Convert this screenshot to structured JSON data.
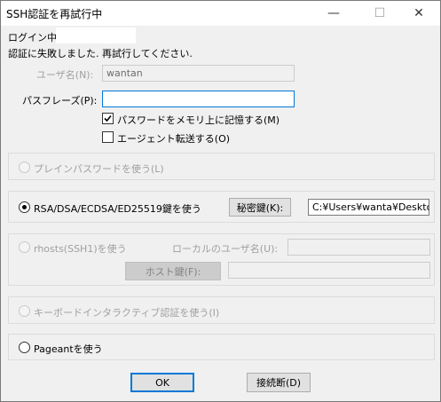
{
  "window": {
    "title": "SSH認証を再試行中",
    "minimize_glyph": "—",
    "maximize_glyph": "☐",
    "close_glyph": "✕"
  },
  "login": {
    "label": "ログイン中:",
    "message": "認証に失敗しました. 再試行してください."
  },
  "username": {
    "label": "ユーザ名(N):",
    "value": "wantan"
  },
  "passphrase": {
    "label": "パスフレーズ(P):",
    "value": ""
  },
  "options": {
    "remember_password": {
      "label": "パスワードをメモリ上に記憶する(M)",
      "checked": true
    },
    "agent_forwarding": {
      "label": "エージェント転送する(O)",
      "checked": false
    }
  },
  "auth_methods": {
    "plain_password": {
      "label": "プレインパスワードを使う(L)",
      "enabled": false,
      "selected": false
    },
    "rsa": {
      "label": "RSA/DSA/ECDSA/ED25519鍵を使う",
      "selected": true,
      "secret_key_button": "秘密鍵(K):",
      "key_path": "C:¥Users¥wanta¥Desktop"
    },
    "rhosts": {
      "label": "rhosts(SSH1)を使う",
      "local_user_label": "ローカルのユーザ名(U):",
      "local_user_value": "",
      "host_key_button": "ホスト鍵(F):",
      "host_key_value": "",
      "enabled": false
    },
    "keyboard_interactive": {
      "label": "キーボードインタラクティブ認証を使う(I)",
      "enabled": false
    },
    "pageant": {
      "label": "Pageantを使う",
      "selected": false
    }
  },
  "buttons": {
    "ok": "OK",
    "disconnect": "接続断(D)"
  },
  "colors": {
    "focus_border": "#0078d7",
    "disabled_text": "#a0a0a0",
    "window_bg": "#f0f0f0"
  }
}
